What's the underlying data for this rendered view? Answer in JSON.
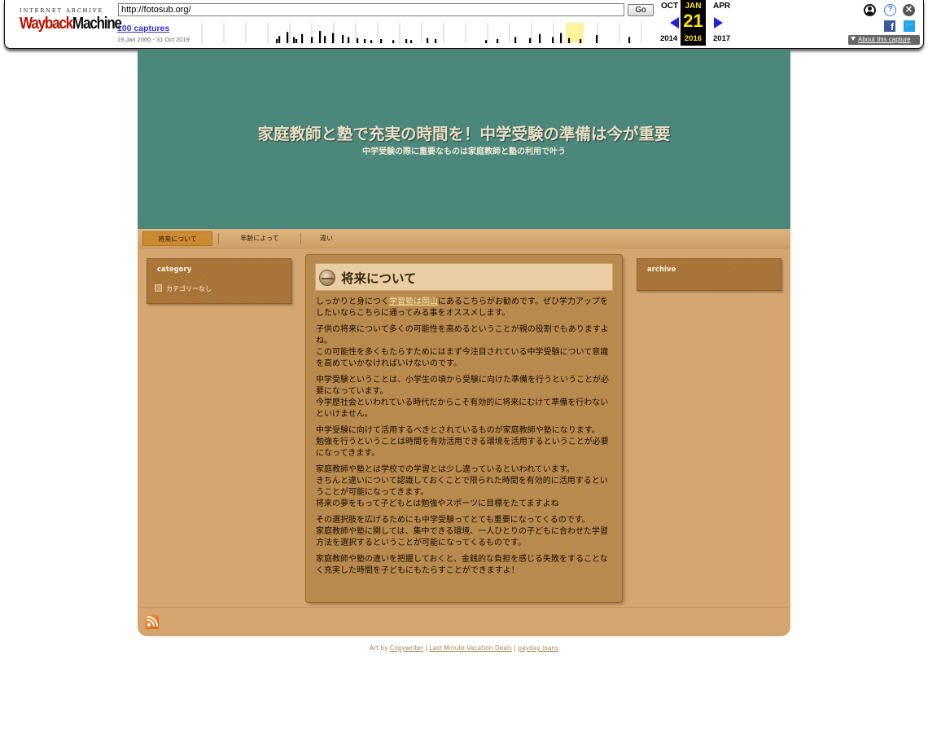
{
  "wayback": {
    "logo_top": "INTERNET ARCHIVE",
    "logo_word1": "Wayback",
    "logo_word2": "Machine",
    "url": "http://fotosub.org/",
    "go_label": "Go",
    "captures_label": "100 captures",
    "date_range": "19 Jan 2000 - 31 Oct 2019",
    "prev_month": "OCT",
    "prev_year": "2014",
    "current_month": "JAN",
    "current_day": "21",
    "current_year": "2016",
    "next_month": "APR",
    "next_year": "2017",
    "about_label": "About this capture",
    "help_glyph": "?",
    "close_glyph": "✕",
    "facebook_glyph": "f",
    "twitter_glyph": "🐦",
    "sparkline_bars": [
      0.2,
      0.35,
      0.55,
      0.3,
      0.2,
      0.45,
      0.3,
      0.6,
      0.35,
      0.5,
      0.4,
      0.3,
      0.25,
      0.2,
      0.15,
      0.2,
      0.15,
      0.2,
      0.15,
      0.25,
      0.2,
      0.15,
      0.2,
      0.3,
      0.25,
      0.45,
      0.3,
      0.5,
      0.25,
      0.2,
      0.4,
      0.3
    ],
    "colors": {
      "accent_blue": "#2222dd",
      "highlight": "#ffe400"
    }
  },
  "site": {
    "title": "家庭教師と塾で充実の時間を！中学受験の準備は今が重要",
    "subtitle": "中学受験の際に重要なものは家庭教師と塾の利用で叶う",
    "nav": [
      {
        "label": "将来について"
      },
      {
        "label": "年齢によって"
      },
      {
        "label": "違い"
      }
    ],
    "sidebar_left": {
      "title": "category",
      "items": [
        {
          "label": "カテゴリーなし"
        }
      ]
    },
    "sidebar_right": {
      "title": "archive"
    },
    "post": {
      "title": "将来について",
      "intro_before_link": "しっかりと身につく",
      "intro_link": "学習塾は岡山",
      "intro_after_link": "にあるこちらがお勧めです。ぜひ学力アップをしたいならこちらに通ってみる事をオススメします。",
      "paragraphs": [
        "子供の将来について多くの可能性を高めるということが親の役割でもありますよね。\nこの可能性を多くもたらすためにはまず今注目されている中学受験について意識を高めていかなければいけないのです。",
        "中学受験ということは、小学生の頃から受験に向けた準備を行うということが必要になっています。\n今学歴社会といわれている時代だからこそ有効的に将来にむけて準備を行わないといけません。",
        "中学受験に向けて活用するべきとされているものが家庭教師や塾になります。\n勉強を行うということは時間を有効活用できる環境を活用するということが必要になってきます。",
        "家庭教師や塾とは学校での学習とは少し違っているといわれています。\nきちんと違いについて認識しておくことで限られた時間を有効的に活用するということが可能になってきます。\n将来の夢をもって子どもとは勉強やスポーツに目標をたてますよね",
        "その選択肢を広げるためにも中学受験ってとても重要になってくるのです。\n家庭教師や塾に関しては、集中できる環境、一人ひとりの子どもに合わせた学習方法を選択するということが可能になってくるものです。",
        "家庭教師や塾の違いを把握しておくと、金銭的な負担を感じる失敗をすることなく充実した時間を子どもにもたらすことができますよ！"
      ]
    },
    "credits": {
      "prefix": "Art by ",
      "link1": "Copywriter",
      "sep1": " | ",
      "link2": "Last Minute Vacation Deals",
      "sep2": " | ",
      "link3": "payday loans"
    },
    "colors": {
      "header_bg": "#4b877b",
      "page_bg": "#d4a56e",
      "widget_bg": "#a87235",
      "content_bg": "#b98a4e"
    }
  }
}
